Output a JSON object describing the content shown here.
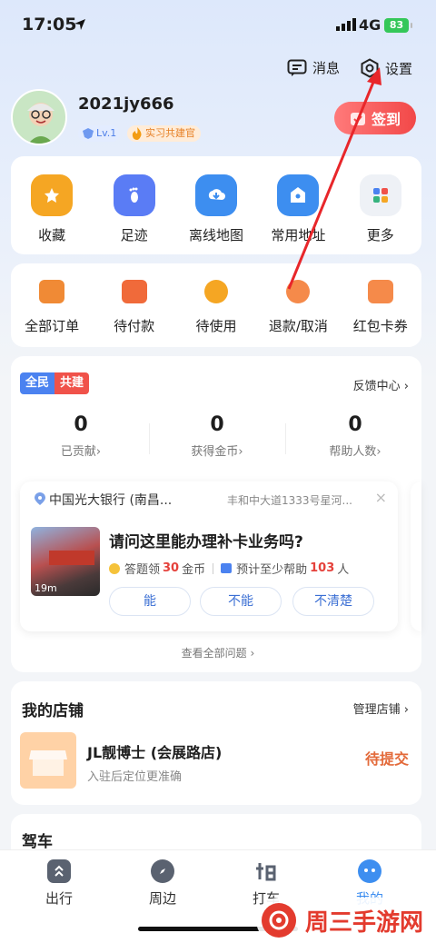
{
  "status": {
    "time": "17:05",
    "network": "4G",
    "battery": "83"
  },
  "header": {
    "messages_label": "消息",
    "settings_label": "设置"
  },
  "user": {
    "name": "2021jy666",
    "level": "Lv.1",
    "title_badge": "实习共建官",
    "checkin_label": "签到"
  },
  "quick_actions": [
    {
      "label": "收藏",
      "icon": "star-icon",
      "color": "#f5a623"
    },
    {
      "label": "足迹",
      "icon": "footprint-icon",
      "color": "#5a7cf5"
    },
    {
      "label": "离线地图",
      "icon": "download-cloud-icon",
      "color": "#3d8ef0"
    },
    {
      "label": "常用地址",
      "icon": "home-pin-icon",
      "color": "#3d8ef0"
    },
    {
      "label": "更多",
      "icon": "grid-icon",
      "color": "#eef1f6"
    }
  ],
  "orders": [
    {
      "label": "全部订单",
      "icon": "orders-icon",
      "color": "#f08a35"
    },
    {
      "label": "待付款",
      "icon": "wallet-icon",
      "color": "#f06a3a"
    },
    {
      "label": "待使用",
      "icon": "clock-icon",
      "color": "#f5a623"
    },
    {
      "label": "退款/取消",
      "icon": "refund-icon",
      "color": "#f58a4a"
    },
    {
      "label": "红包卡券",
      "icon": "coupon-icon",
      "color": "#f58a4a"
    }
  ],
  "community": {
    "tag_left": "全民",
    "tag_right": "共建",
    "feedback_label": "反馈中心",
    "stats": [
      {
        "value": "0",
        "label": "已贡献"
      },
      {
        "value": "0",
        "label": "获得金币"
      },
      {
        "value": "0",
        "label": "帮助人数"
      }
    ],
    "question": {
      "poi_name": "中国光大银行 (南昌...",
      "poi_address": "丰和中大道1333号星河...",
      "video_duration": "19m",
      "title": "请问这里能办理补卡业务吗?",
      "reward_prefix": "答题领",
      "reward_value": "30",
      "reward_suffix": "金币",
      "help_prefix": "预计至少帮助",
      "help_value": "103",
      "help_suffix": "人",
      "options": [
        "能",
        "不能",
        "不清楚"
      ]
    },
    "view_all_label": "查看全部问题"
  },
  "shop": {
    "title": "我的店铺",
    "manage_label": "管理店铺",
    "name": "JL靓博士 (会展路店)",
    "subtitle": "入驻后定位更准确",
    "status": "待提交"
  },
  "drive": {
    "title": "驾车"
  },
  "tabs": [
    {
      "label": "出行",
      "icon": "route-icon"
    },
    {
      "label": "周边",
      "icon": "compass-icon"
    },
    {
      "label": "打车",
      "icon": "taxi-icon"
    },
    {
      "label": "我的",
      "icon": "profile-icon"
    }
  ],
  "watermark": {
    "text": "周三手游网"
  },
  "colors": {
    "accent": "#3d8ef0",
    "checkin": "#f24848",
    "arrow": "#e8262a",
    "status": "#e36a3a"
  }
}
